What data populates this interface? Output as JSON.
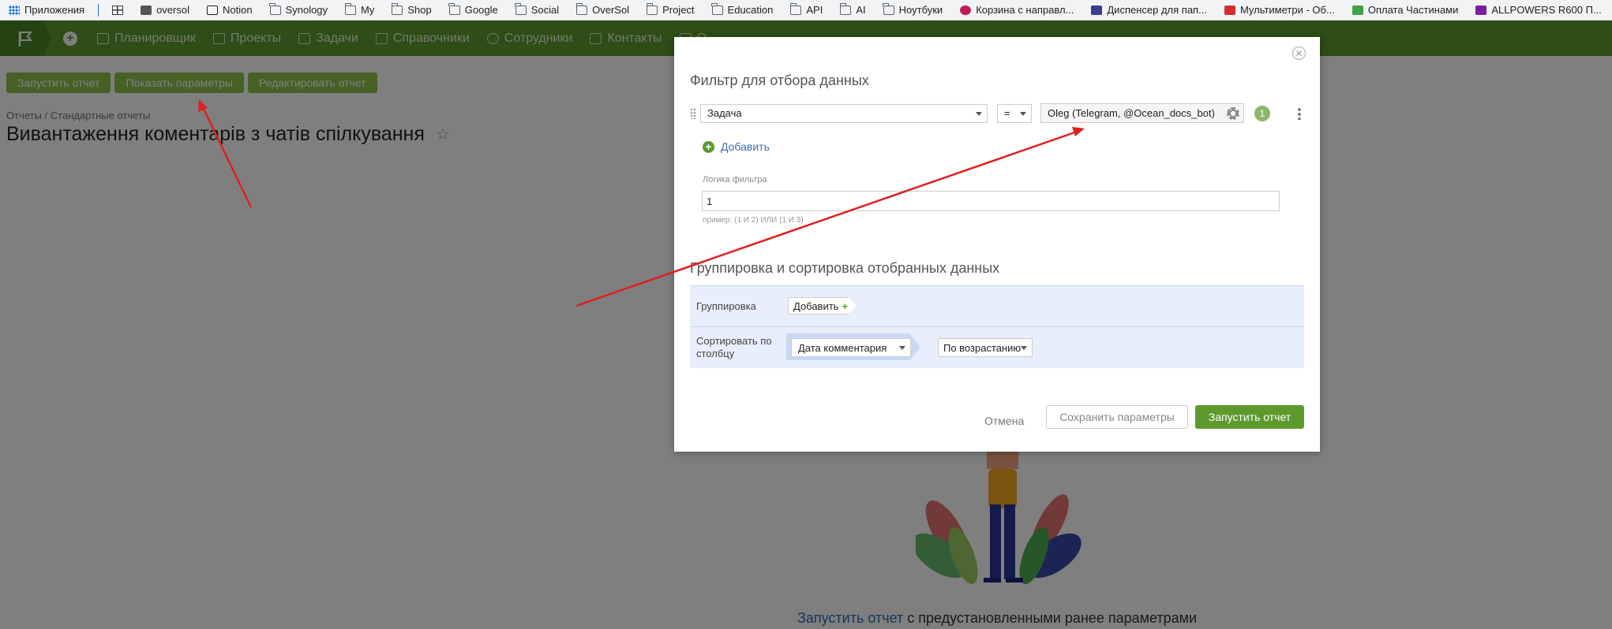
{
  "bookmarks": [
    {
      "label": "Приложения",
      "icon": "apps-icon"
    },
    {
      "label": "",
      "icon": "grid-icon"
    },
    {
      "label": "oversol",
      "icon": "site-icon"
    },
    {
      "label": "Notion",
      "icon": "notion-icon"
    },
    {
      "label": "Synology",
      "icon": "folder-icon"
    },
    {
      "label": "My",
      "icon": "folder-icon"
    },
    {
      "label": "Shop",
      "icon": "folder-icon"
    },
    {
      "label": "Google",
      "icon": "folder-icon"
    },
    {
      "label": "Social",
      "icon": "folder-icon"
    },
    {
      "label": "OverSol",
      "icon": "folder-icon"
    },
    {
      "label": "Project",
      "icon": "folder-icon"
    },
    {
      "label": "Education",
      "icon": "folder-icon"
    },
    {
      "label": "API",
      "icon": "folder-icon"
    },
    {
      "label": "AI",
      "icon": "folder-icon"
    },
    {
      "label": "Ноутбуки",
      "icon": "folder-icon"
    },
    {
      "label": "Корзина с направл...",
      "icon": "site-icon"
    },
    {
      "label": "Диспенсер для пап...",
      "icon": "site-icon"
    },
    {
      "label": "Мультиметри - Об...",
      "icon": "site-icon"
    },
    {
      "label": "Оплата Частинами",
      "icon": "site-icon"
    },
    {
      "label": "ALLPOWERS R600 П...",
      "icon": "site-icon"
    }
  ],
  "nav": {
    "items": [
      "Планировщик",
      "Проекты",
      "Задачи",
      "Справочники",
      "Сотрудники",
      "Контакты",
      "О"
    ]
  },
  "toolbar": {
    "run": "Запустить отчет",
    "show_params": "Показать параметры",
    "edit": "Редактировать отчет"
  },
  "breadcrumb": "Отчеты / Стандартные отчеты",
  "page_title": "Вивантаження коментарів з чатів спілкування",
  "empty_state": {
    "link": "Запустить отчет",
    "text": " с предустановленными ранее параметрами"
  },
  "modal": {
    "filter_title": "Фильтр для отбора данных",
    "filter": {
      "field": "Задача",
      "operator": "=",
      "value": "Oleg (Telegram, @Ocean_docs_bot)",
      "index": "1"
    },
    "add_label": "Добавить",
    "logic_label": "Логика фильтра",
    "logic_value": "1",
    "logic_hint": "пример: (1 И 2) ИЛИ (1 И 3)",
    "grouping_title": "Группировка и сортировка отобранных данных",
    "grouping_label": "Группировка",
    "grouping_add": "Добавить",
    "sort_label": "Сортировать по столбцу",
    "sort_field": "Дата комментария",
    "sort_order": "По возрастанию",
    "cancel": "Отмена",
    "save": "Сохранить параметры",
    "run": "Запустить отчет"
  },
  "colors": {
    "brand_green": "#5c9a2e",
    "light_green": "#8bc34a",
    "annotation_red": "#e02020"
  }
}
